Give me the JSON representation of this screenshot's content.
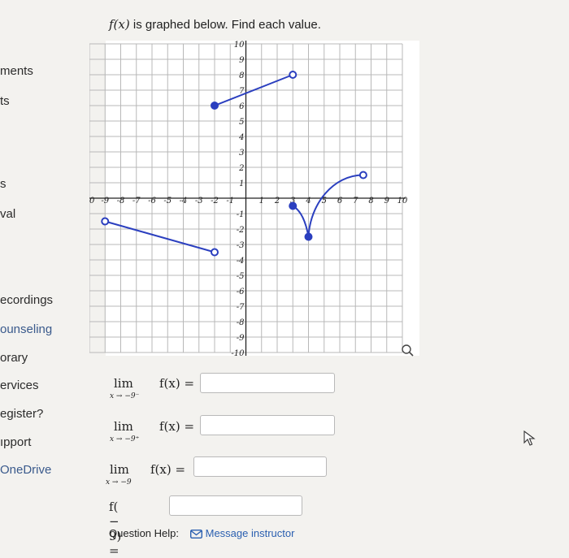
{
  "sidebar": {
    "items": [
      {
        "label": "ments",
        "link": false
      },
      {
        "label": "ts",
        "link": false
      },
      {
        "label": "s",
        "link": false
      },
      {
        "label": "val",
        "link": false
      },
      {
        "label": "ecordings",
        "link": false
      },
      {
        "label": "ounseling",
        "link": true
      },
      {
        "label": "orary",
        "link": false
      },
      {
        "label": "ervices",
        "link": false
      },
      {
        "label": "egister?",
        "link": false
      },
      {
        "label": "ıpport",
        "link": false
      },
      {
        "label": "OneDrive",
        "link": true
      }
    ]
  },
  "question": {
    "prompt_fx": "f(x)",
    "prompt_text": " is graphed below. Find each value."
  },
  "graph": {
    "x_ticks": [
      "10",
      "-9",
      "-8",
      "-7",
      "-6",
      "-5",
      "-4",
      "-3",
      "-2",
      "-1",
      "1",
      "2",
      "3",
      "4",
      "5",
      "6",
      "7",
      "8",
      "9",
      "10"
    ],
    "y_ticks": [
      "10",
      "9",
      "8",
      "7",
      "6",
      "5",
      "4",
      "3",
      "2",
      "1",
      "-1",
      "-2",
      "-3",
      "-4",
      "-5",
      "-6",
      "-7",
      "-8",
      "-9",
      "-10"
    ],
    "segments": [
      {
        "from": [
          -2,
          6
        ],
        "to": [
          3,
          8
        ],
        "from_closed": true,
        "to_closed": false
      },
      {
        "from": [
          -9,
          -1.5
        ],
        "to": [
          -2,
          -3.5
        ],
        "from_closed": false,
        "to_closed": false
      }
    ],
    "v_curve": {
      "start": [
        3,
        -0.5
      ],
      "vertex": [
        4,
        -2.5
      ],
      "start_closed": true,
      "vertex_closed": true
    },
    "sqrt_curve": {
      "from": [
        4,
        -2.5
      ],
      "to": [
        7.5,
        1.5
      ],
      "to_closed": false
    },
    "line_color": "#2b3fbf",
    "zoom_icon": "magnifier-icon"
  },
  "limits": [
    {
      "word": "lim",
      "sub": "x → −9⁻",
      "expr": "f(x) =",
      "answer": ""
    },
    {
      "word": "lim",
      "sub": "x → −9⁺",
      "expr": "f(x) =",
      "answer": ""
    },
    {
      "word": "lim",
      "sub": "x → −9",
      "expr": "f(x) =",
      "answer": ""
    }
  ],
  "value_question": {
    "expr": "f( − 9) =",
    "answer": ""
  },
  "help": {
    "label": "Question Help:",
    "message_icon": "envelope-icon",
    "message_label": "Message instructor"
  },
  "cursor_icon": "pointer-cursor-icon"
}
